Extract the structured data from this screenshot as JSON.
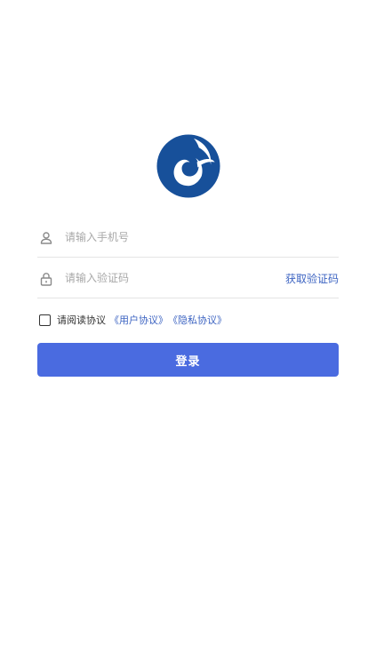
{
  "logo": {
    "icon": "swirl-logo",
    "color": "#17509a"
  },
  "phone_field": {
    "icon": "user-icon",
    "placeholder": "请输入手机号",
    "value": ""
  },
  "code_field": {
    "icon": "lock-icon",
    "placeholder": "请输入验证码",
    "value": "",
    "get_code_label": "获取验证码"
  },
  "agreement": {
    "checked": false,
    "text": "请阅读协议",
    "user_agreement": "《用户协议》",
    "privacy_agreement": "《隐私协议》"
  },
  "login_button": {
    "label": "登录"
  },
  "colors": {
    "primary": "#4a6be0",
    "link": "#3d64c2",
    "logo": "#17509a"
  }
}
